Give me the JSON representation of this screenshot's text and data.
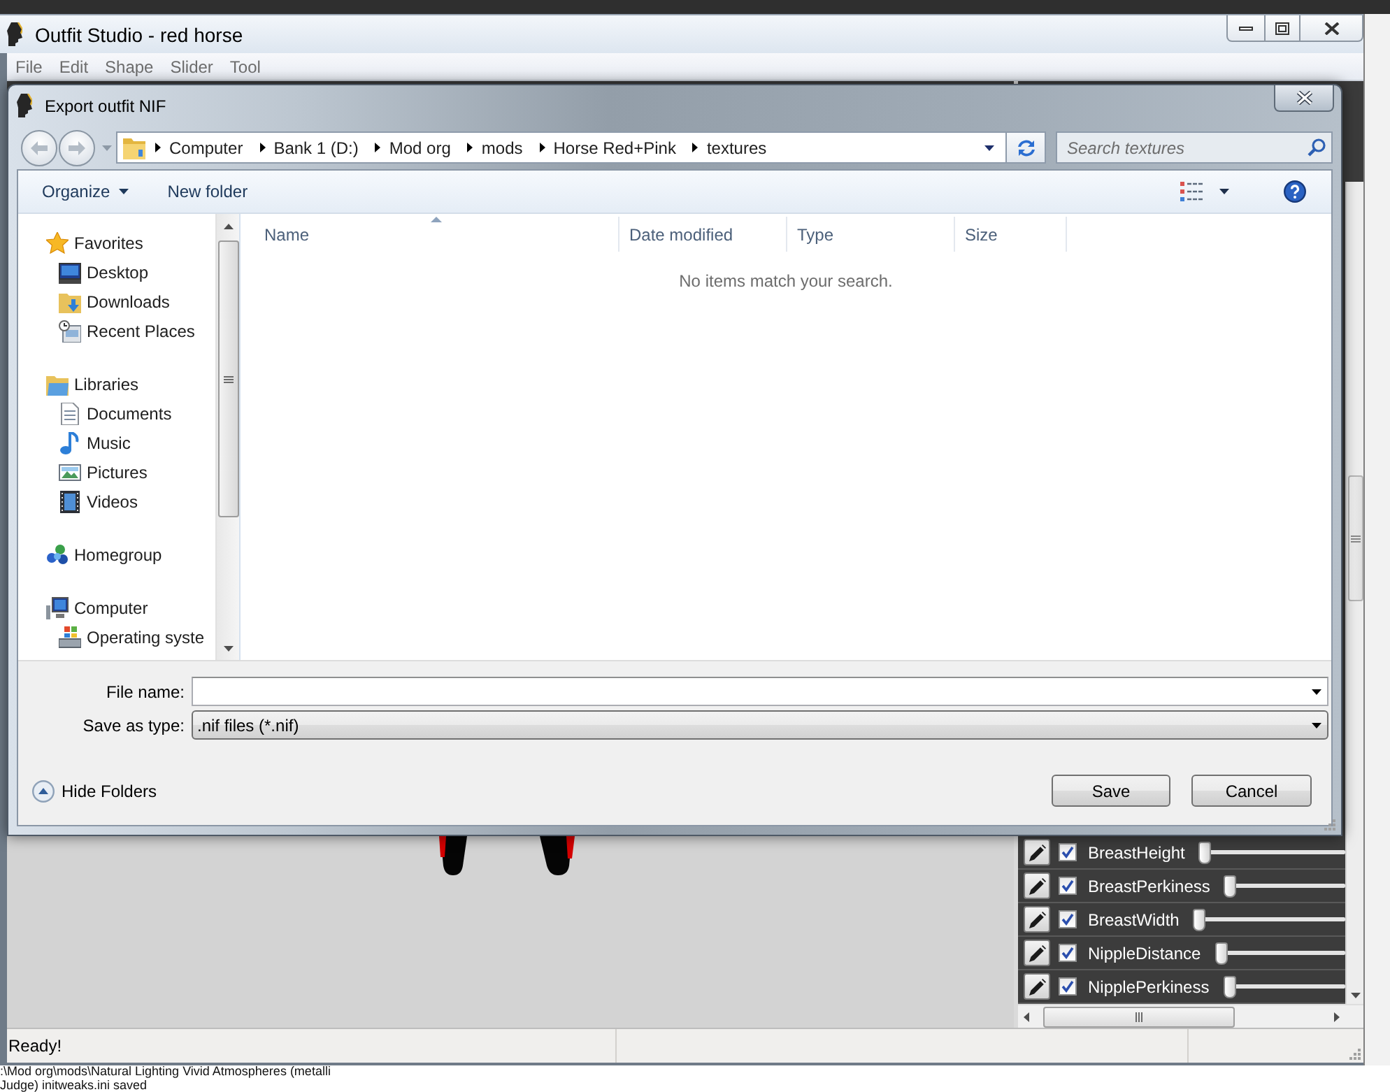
{
  "window": {
    "title": "Outfit Studio - red horse"
  },
  "menu": [
    "File",
    "Edit",
    "Shape",
    "Slider",
    "Tool"
  ],
  "dialog": {
    "title": "Export outfit NIF",
    "breadcrumb": [
      "Computer",
      "Bank 1 (D:)",
      "Mod org",
      "mods",
      "Horse Red+Pink",
      "textures"
    ],
    "search": {
      "placeholder": "Search textures"
    },
    "toolbar": {
      "organize": "Organize",
      "new_folder": "New folder"
    },
    "nav": [
      {
        "label": "Favorites",
        "kind": "favorites",
        "children": [
          {
            "label": "Desktop",
            "kind": "desktop"
          },
          {
            "label": "Downloads",
            "kind": "downloads"
          },
          {
            "label": "Recent Places",
            "kind": "recent"
          }
        ]
      },
      {
        "label": "Libraries",
        "kind": "libraries",
        "children": [
          {
            "label": "Documents",
            "kind": "documents"
          },
          {
            "label": "Music",
            "kind": "music"
          },
          {
            "label": "Pictures",
            "kind": "pictures"
          },
          {
            "label": "Videos",
            "kind": "videos"
          }
        ]
      },
      {
        "label": "Homegroup",
        "kind": "homegroup"
      },
      {
        "label": "Computer",
        "kind": "computer",
        "children": [
          {
            "label": "Operating syste",
            "kind": "drive"
          }
        ]
      }
    ],
    "columns": [
      {
        "label": "Name",
        "sorted": true
      },
      {
        "label": "Date modified",
        "sorted": false
      },
      {
        "label": "Type",
        "sorted": false
      },
      {
        "label": "Size",
        "sorted": false
      }
    ],
    "empty_message": "No items match your search.",
    "file_name": {
      "label": "File name:"
    },
    "save_as_type": {
      "label": "Save as type:",
      "value": ".nif files (*.nif)"
    },
    "hide_folders": "Hide Folders",
    "buttons": [
      "Save",
      "Cancel"
    ]
  },
  "sliders": [
    {
      "name": "BreastHeight",
      "checked": true,
      "level": 0
    },
    {
      "name": "BreastPerkiness",
      "checked": true,
      "level": 0
    },
    {
      "name": "BreastWidth",
      "checked": true,
      "level": 0
    },
    {
      "name": "NippleDistance",
      "checked": true,
      "level": 0
    },
    {
      "name": "NipplePerkiness",
      "checked": true,
      "level": 0
    }
  ],
  "status_bar": {
    "text": "Ready!"
  },
  "console": [
    ":\\Mod org\\mods\\Natural Lighting Vivid Atmospheres (metalli",
    "Judge) initweaks.ini saved"
  ]
}
